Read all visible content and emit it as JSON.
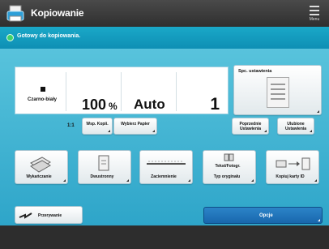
{
  "app": {
    "title": "Kopiowanie",
    "menu_label": "Menu",
    "status_message": "Gotowy do kopiowania."
  },
  "settings": {
    "color_mode": "Czarno-biały",
    "ratio": "100",
    "ratio_unit": "%",
    "paper": "Auto",
    "copies": "1",
    "special_settings_label": "Spc. ustawienia"
  },
  "row2": {
    "ratio_one_to_one": "1:1",
    "ratio_button": "Wsp. Kopii.",
    "paper_button": "Wybierz Papier",
    "previous_settings": "Poprzednie Ustawienia",
    "favorite_settings": "Ulubione Ustawienia"
  },
  "functions": [
    {
      "label": "Wykańczanie",
      "icon": "finishing-icon"
    },
    {
      "label": "Dwustronny",
      "icon": "two-sided-icon"
    },
    {
      "label": "Zaciemnienie",
      "icon": "density-icon"
    },
    {
      "label": "Typ oryginału",
      "icon": "original-type-icon",
      "top_label": "Tekst/Fotogr."
    },
    {
      "label": "Kopiuj karty ID",
      "icon": "id-card-copy-icon"
    }
  ],
  "bottom": {
    "interrupt_label": "Przerywanie",
    "options_label": "Opcje"
  },
  "colors": {
    "accent_blue": "#2ea5c9",
    "status_bar": "#1aa8c8",
    "options_button": "#1867ad"
  }
}
